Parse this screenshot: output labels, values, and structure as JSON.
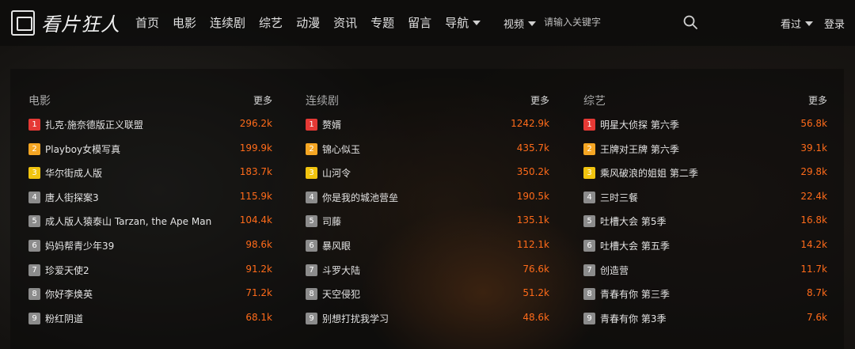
{
  "header": {
    "logo_text": "看片狂人",
    "nav": [
      "首页",
      "电影",
      "连续剧",
      "综艺",
      "动漫",
      "资讯",
      "专题",
      "留言",
      "导航"
    ],
    "video_select": "视频",
    "search_placeholder": "请输入关键字",
    "history_label": "看过",
    "login_label": "登录"
  },
  "columns": [
    {
      "title": "电影",
      "more": "更多",
      "items": [
        {
          "rank": "1",
          "name": "扎克·施奈德版正义联盟",
          "count": "296.2k"
        },
        {
          "rank": "2",
          "name": "Playboy女模写真",
          "count": "199.9k"
        },
        {
          "rank": "3",
          "name": "华尔街成人版",
          "count": "183.7k"
        },
        {
          "rank": "4",
          "name": "唐人街探案3",
          "count": "115.9k"
        },
        {
          "rank": "5",
          "name": "成人版人猿泰山 Tarzan, the Ape Man",
          "count": "104.4k"
        },
        {
          "rank": "6",
          "name": "妈妈帮青少年39",
          "count": "98.6k"
        },
        {
          "rank": "7",
          "name": "珍爱天使2",
          "count": "91.2k"
        },
        {
          "rank": "8",
          "name": "你好李焕英",
          "count": "71.2k"
        },
        {
          "rank": "9",
          "name": "粉红阴道",
          "count": "68.1k"
        }
      ]
    },
    {
      "title": "连续剧",
      "more": "更多",
      "items": [
        {
          "rank": "1",
          "name": "赘婿",
          "count": "1242.9k"
        },
        {
          "rank": "2",
          "name": "锦心似玉",
          "count": "435.7k"
        },
        {
          "rank": "3",
          "name": "山河令",
          "count": "350.2k"
        },
        {
          "rank": "4",
          "name": "你是我的城池营垒",
          "count": "190.5k"
        },
        {
          "rank": "5",
          "name": "司藤",
          "count": "135.1k"
        },
        {
          "rank": "6",
          "name": "暴风眼",
          "count": "112.1k"
        },
        {
          "rank": "7",
          "name": "斗罗大陆",
          "count": "76.6k"
        },
        {
          "rank": "8",
          "name": "天空侵犯",
          "count": "51.2k"
        },
        {
          "rank": "9",
          "name": "别想打扰我学习",
          "count": "48.6k"
        }
      ]
    },
    {
      "title": "综艺",
      "more": "更多",
      "items": [
        {
          "rank": "1",
          "name": "明星大侦探 第六季",
          "count": "56.8k"
        },
        {
          "rank": "2",
          "name": "王牌对王牌 第六季",
          "count": "39.1k"
        },
        {
          "rank": "3",
          "name": "乘风破浪的姐姐 第二季",
          "count": "29.8k"
        },
        {
          "rank": "4",
          "name": "三时三餐",
          "count": "22.4k"
        },
        {
          "rank": "5",
          "name": "吐槽大会 第5季",
          "count": "16.8k"
        },
        {
          "rank": "6",
          "name": "吐槽大会 第五季",
          "count": "14.2k"
        },
        {
          "rank": "7",
          "name": "创造营",
          "count": "11.7k"
        },
        {
          "rank": "8",
          "name": "青春有你 第三季",
          "count": "8.7k"
        },
        {
          "rank": "9",
          "name": "青春有你 第3季",
          "count": "7.6k"
        }
      ]
    }
  ],
  "colors": {
    "rank1": "#e53935",
    "rank2": "#f5a623",
    "rank3": "#f1c40f",
    "rank_other": "#8c8c8c",
    "count": "#ff6b1a"
  }
}
